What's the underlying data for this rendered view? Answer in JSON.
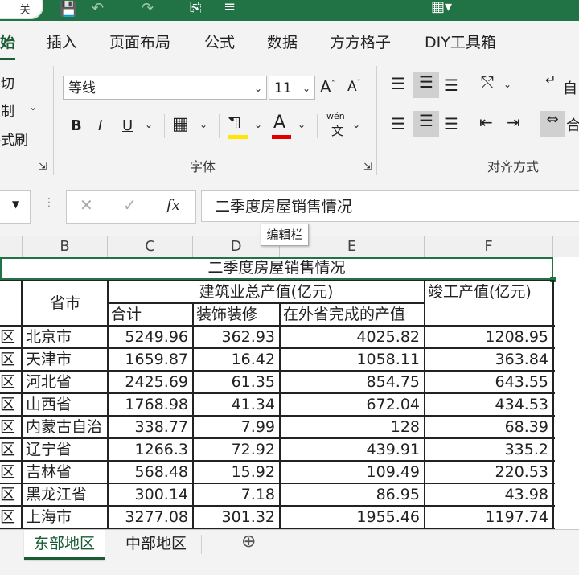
{
  "titlebar": {
    "autosave_toggle": "关"
  },
  "tabs": [
    "始",
    "插入",
    "页面布局",
    "公式",
    "数据",
    "方方格子",
    "DIY工具箱"
  ],
  "ribbon": {
    "clipboard": {
      "cut": "剪切",
      "copy": "复制",
      "format_painter": "格式刷"
    },
    "font": {
      "name": "等线",
      "size": "11",
      "bold": "B",
      "italic": "I",
      "underline": "U",
      "wen": "wén",
      "wen_char": "文",
      "group_label": "字体"
    },
    "alignment": {
      "group_label": "对齐方式",
      "wrap": "自",
      "merge": "合"
    },
    "highlight_color": "#ffe600",
    "font_color": "#e00000"
  },
  "formula_bar": {
    "content": "二季度房屋销售情况",
    "tooltip": "编辑栏",
    "fx": "fx"
  },
  "columns": [
    "B",
    "C",
    "D",
    "E",
    "F"
  ],
  "sheet": {
    "title": "二季度房屋销售情况",
    "header_province": "省市",
    "header_construction": "建筑业总产值(亿元)",
    "header_total": "合计",
    "header_decoration": "装饰装修",
    "header_other_province": "在外省完成的产值",
    "header_completed": "竣工产值(亿元)",
    "rows": [
      {
        "region": "区",
        "province": "北京市",
        "total": "5249.96",
        "decoration": "362.93",
        "other": "4025.82",
        "completed": "1208.95"
      },
      {
        "region": "区",
        "province": "天津市",
        "total": "1659.87",
        "decoration": "16.42",
        "other": "1058.11",
        "completed": "363.84"
      },
      {
        "region": "区",
        "province": "河北省",
        "total": "2425.69",
        "decoration": "61.35",
        "other": "854.75",
        "completed": "643.55"
      },
      {
        "region": "区",
        "province": "山西省",
        "total": "1768.98",
        "decoration": "41.34",
        "other": "672.04",
        "completed": "434.53"
      },
      {
        "region": "区",
        "province": "内蒙古自治",
        "total": "338.77",
        "decoration": "7.99",
        "other": "128",
        "completed": "68.39"
      },
      {
        "region": "区",
        "province": "辽宁省",
        "total": "1266.3",
        "decoration": "72.92",
        "other": "439.91",
        "completed": "335.2"
      },
      {
        "region": "区",
        "province": "吉林省",
        "total": "568.48",
        "decoration": "15.92",
        "other": "109.49",
        "completed": "220.53"
      },
      {
        "region": "区",
        "province": "黑龙江省",
        "total": "300.14",
        "decoration": "7.18",
        "other": "86.95",
        "completed": "43.98"
      },
      {
        "region": "区",
        "province": "上海市",
        "total": "3277.08",
        "decoration": "301.32",
        "other": "1955.46",
        "completed": "1197.74"
      }
    ]
  },
  "sheet_tabs": [
    "东部地区",
    "中部地区"
  ],
  "accent_color": "#217346"
}
